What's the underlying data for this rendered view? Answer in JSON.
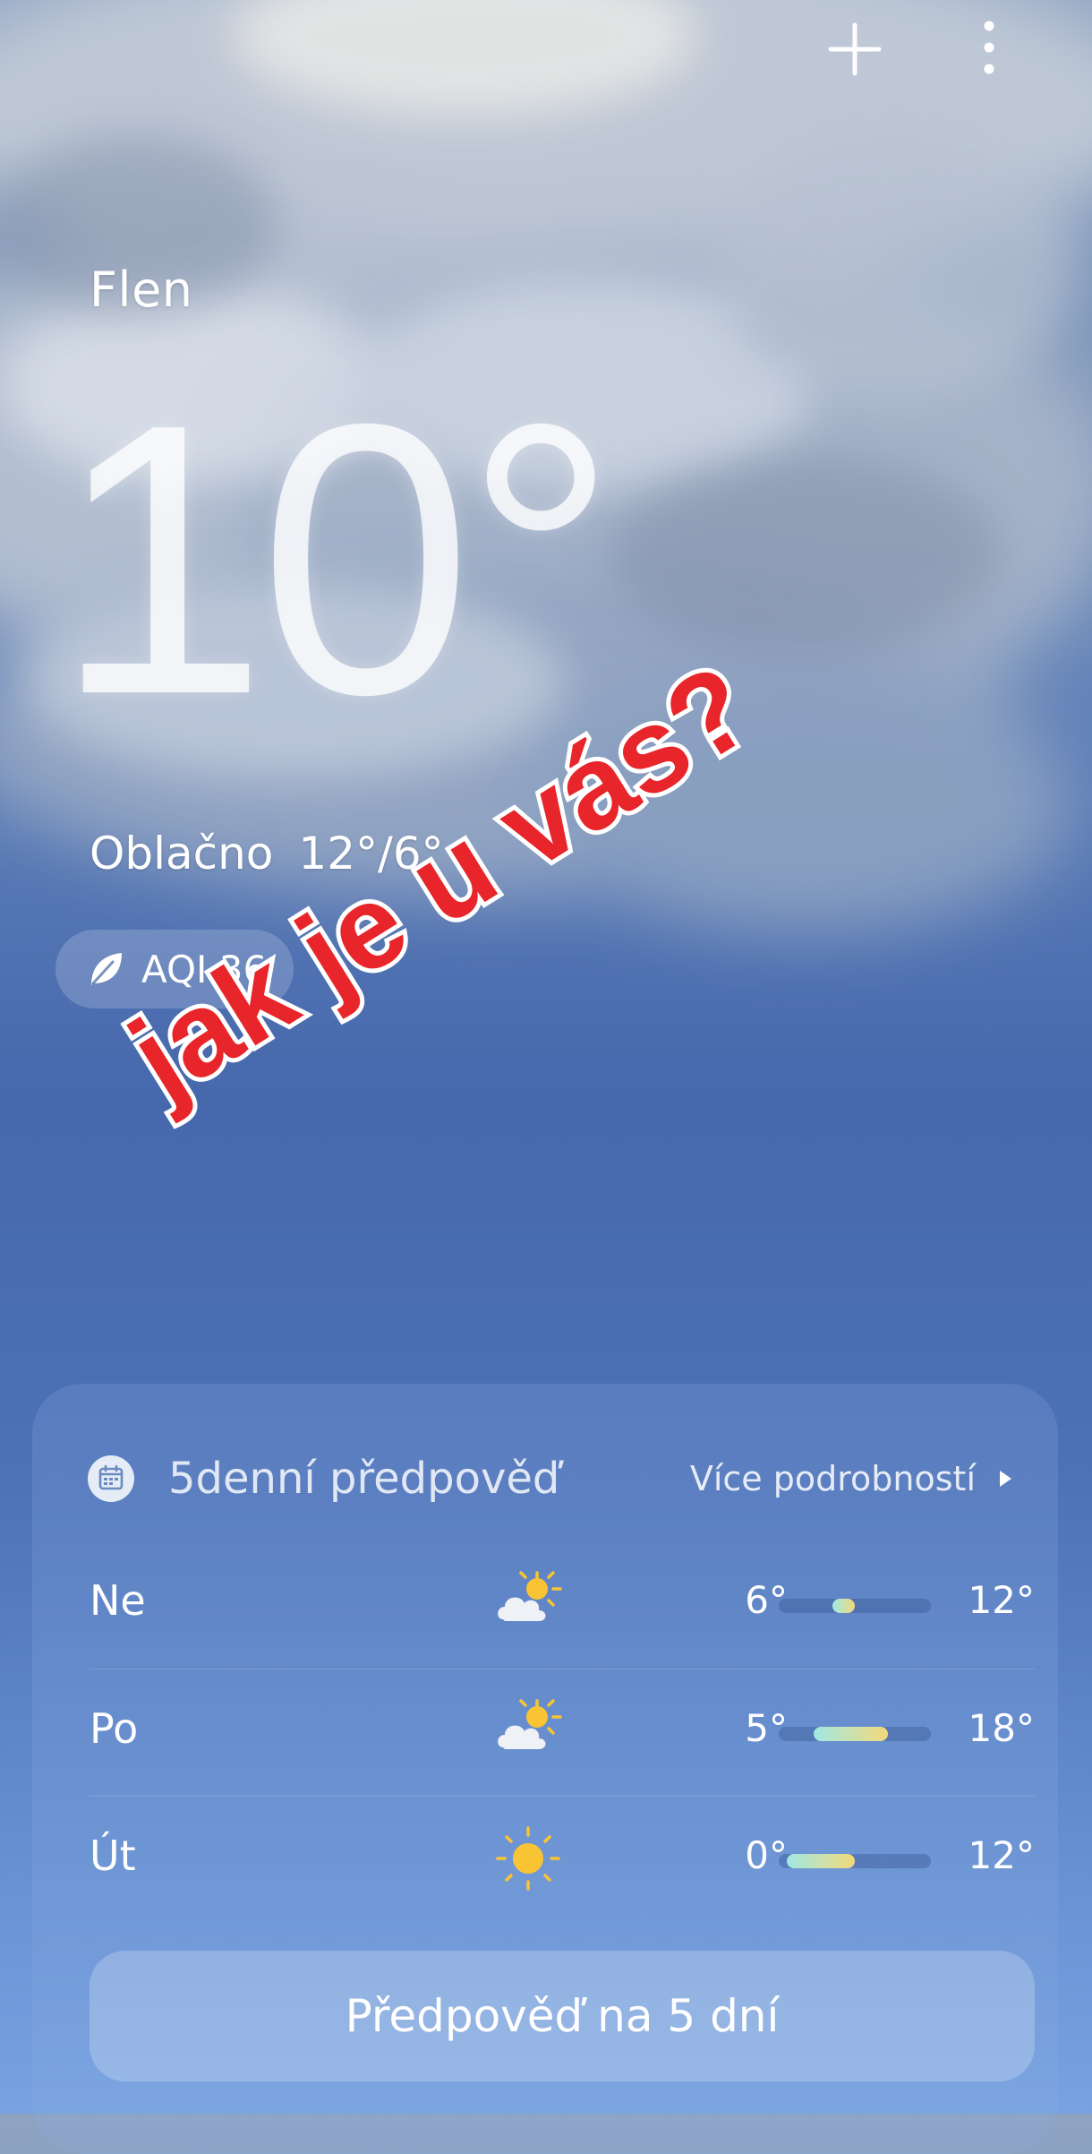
{
  "location": "Flen",
  "current": {
    "temperature": "10°",
    "condition": "Oblačno",
    "high_low": "12°/6°",
    "aqi_label": "AQI 36"
  },
  "overlay_text": "jak je u vás?",
  "forecast": {
    "title": "5denní předpověď",
    "more_label": "Více podrobností",
    "days": [
      {
        "day": "Ne",
        "icon": "partly-cloudy-icon",
        "low": "6°",
        "high": "12°",
        "range_start": 0.35,
        "range_end": 0.5
      },
      {
        "day": "Po",
        "icon": "partly-cloudy-icon",
        "low": "5°",
        "high": "18°",
        "range_start": 0.23,
        "range_end": 0.72
      },
      {
        "day": "Út",
        "icon": "sun-icon",
        "low": "0°",
        "high": "12°",
        "range_start": 0.05,
        "range_end": 0.5
      }
    ],
    "button_label": "Předpověď na 5 dní"
  },
  "colors": {
    "overlay_red": "#e8252a",
    "bar_cool": "#9fe9e3",
    "bar_warm": "#f3d97a",
    "sun": "#f9c434"
  }
}
